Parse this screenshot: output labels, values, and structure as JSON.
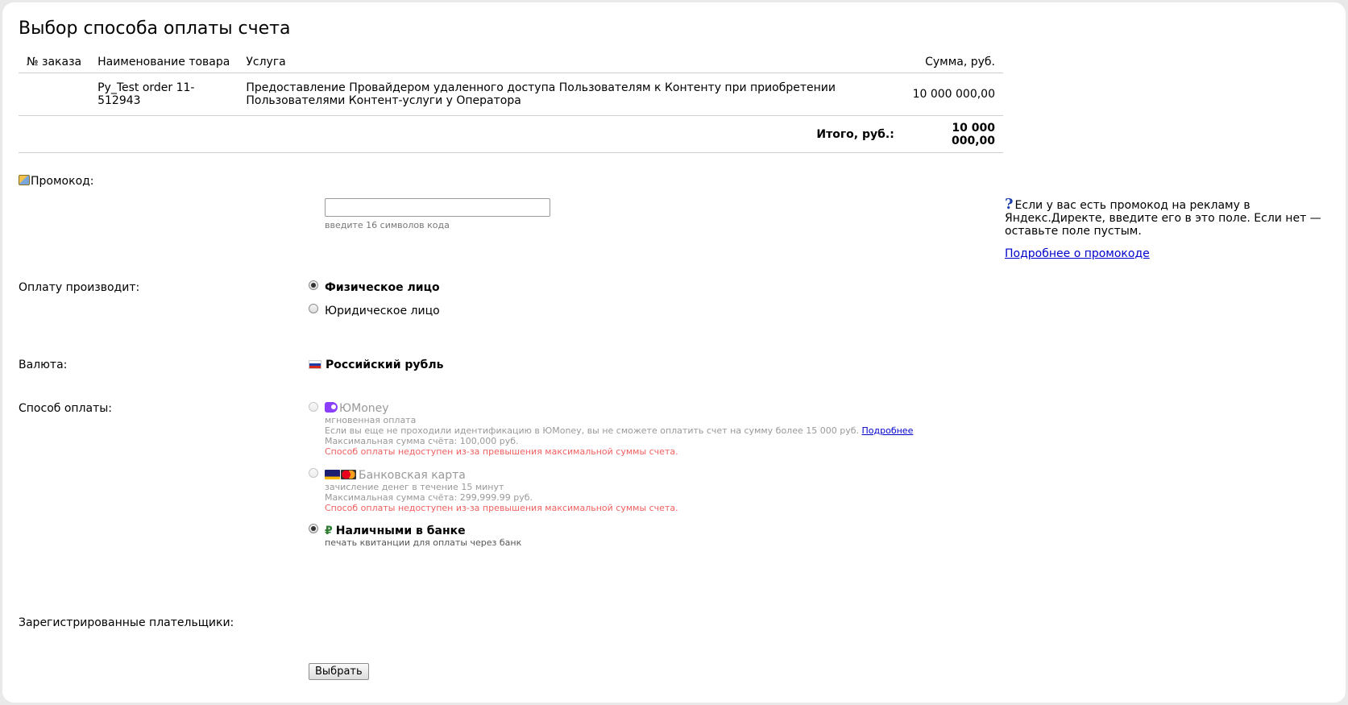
{
  "page": {
    "title": "Выбор способа оплаты счета"
  },
  "order_table": {
    "headers": {
      "order_num": "№ заказа",
      "product": "Наименование товара",
      "service": "Услуга",
      "amount": "Сумма, руб."
    },
    "rows": [
      {
        "order_num": "",
        "product": "Py_Test order 11-512943",
        "service": "Предоставление Провайдером удаленного доступа Пользователям к Контенту при приобретении Пользователями Контент-услуги у Оператора",
        "amount": "10 000 000,00"
      }
    ],
    "total_label": "Итого, руб.:",
    "total_value": "10 000 000,00"
  },
  "promo": {
    "label": "Промокод:",
    "input_value": "",
    "hint": "введите 16 символов кода",
    "help_text": "Если у вас есть промокод на рекламу в Яндекс.Директе, введите его в это поле. Если нет — оставьте поле пустым.",
    "help_link": "Подробнее о промокоде"
  },
  "payer": {
    "label": "Оплату производит:",
    "options": [
      {
        "label": "Физическое лицо",
        "selected": true
      },
      {
        "label": "Юридическое лицо",
        "selected": false
      }
    ]
  },
  "currency": {
    "label": "Валюта:",
    "value": "Российский рубль"
  },
  "payment_method": {
    "label": "Способ оплаты:",
    "options": [
      {
        "name": "ЮMoney",
        "icon": "yoomoney-icon",
        "subtitle": "мгновенная оплата",
        "note": "Если вы еще не проходили идентификацию в ЮMoney, вы не сможете оплатить счет на сумму более 15 000 руб.",
        "note_link": "Подробнее",
        "limit": "Максимальная сумма счёта: 100,000 руб.",
        "error": "Способ оплаты недоступен из-за превышения максимальной суммы счета.",
        "disabled": true,
        "selected": false
      },
      {
        "name": "Банковская карта",
        "icon": "bank-card-icon",
        "subtitle": "зачисление денег в течение 15 минут",
        "limit": "Максимальная сумма счёта: 299,999.99 руб.",
        "error": "Способ оплаты недоступен из-за превышения максимальной суммы счета.",
        "disabled": true,
        "selected": false
      },
      {
        "name": "Наличными в банке",
        "icon": "ruble-icon",
        "subtitle": "печать квитанции для оплаты через банк",
        "disabled": false,
        "selected": true
      }
    ]
  },
  "registered_payers": {
    "label": "Зарегистрированные плательщики:"
  },
  "submit": {
    "label": "Выбрать"
  },
  "colors": {
    "link": "#0000cc",
    "error": "#f06060",
    "disabled_text": "#999999",
    "yoomoney": "#8b3ffd"
  }
}
